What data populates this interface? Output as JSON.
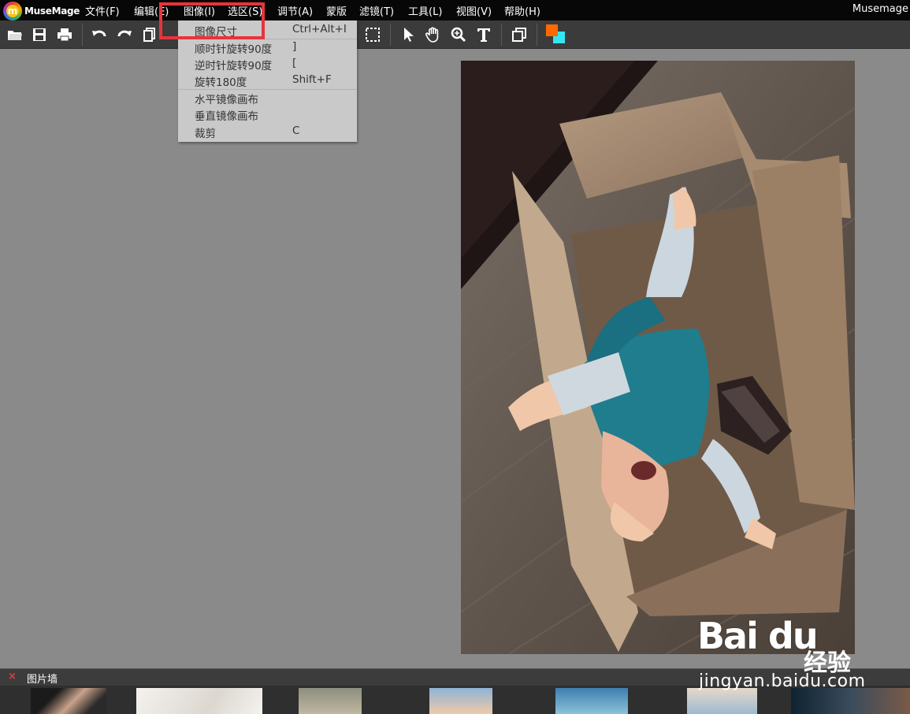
{
  "app": {
    "brand": "MuseMage",
    "brand_mark": "m",
    "window_title": "Musemage"
  },
  "menubar": {
    "items": [
      {
        "label": "文件(F)"
      },
      {
        "label": "编辑(E)"
      },
      {
        "label": "图像(I)"
      },
      {
        "label": "选区(S)"
      },
      {
        "label": "调节(A)"
      },
      {
        "label": "蒙版"
      },
      {
        "label": "滤镜(T)"
      },
      {
        "label": "工具(L)"
      },
      {
        "label": "视图(V)"
      },
      {
        "label": "帮助(H)"
      }
    ]
  },
  "toolbar": {
    "icons": [
      "open-folder",
      "save",
      "print",
      "undo",
      "redo",
      "copy",
      "paste",
      "rect-select",
      "pointer",
      "hand",
      "zoom",
      "text",
      "layers",
      "color-swatch"
    ],
    "foreground_color": "#ff6a00",
    "background_color": "#33e6f2"
  },
  "image_menu": {
    "items": [
      {
        "label": "图像尺寸",
        "shortcut": "Ctrl+Alt+I"
      },
      {
        "label": "顺时针旋转90度",
        "shortcut": "]"
      },
      {
        "label": "逆时针旋转90度",
        "shortcut": "["
      },
      {
        "label": "旋转180度",
        "shortcut": "Shift+F"
      },
      {
        "label": "水平镜像画布",
        "shortcut": ""
      },
      {
        "label": "垂直镜像画布",
        "shortcut": ""
      },
      {
        "label": "裁剪",
        "shortcut": "C"
      }
    ]
  },
  "highlight_color": "#e8343a",
  "photo_wall": {
    "title": "图片墙",
    "close_symbol": "×"
  },
  "watermark": {
    "logo": "Bai du",
    "jingyan": "经验",
    "url": "jingyan.baidu.com"
  }
}
